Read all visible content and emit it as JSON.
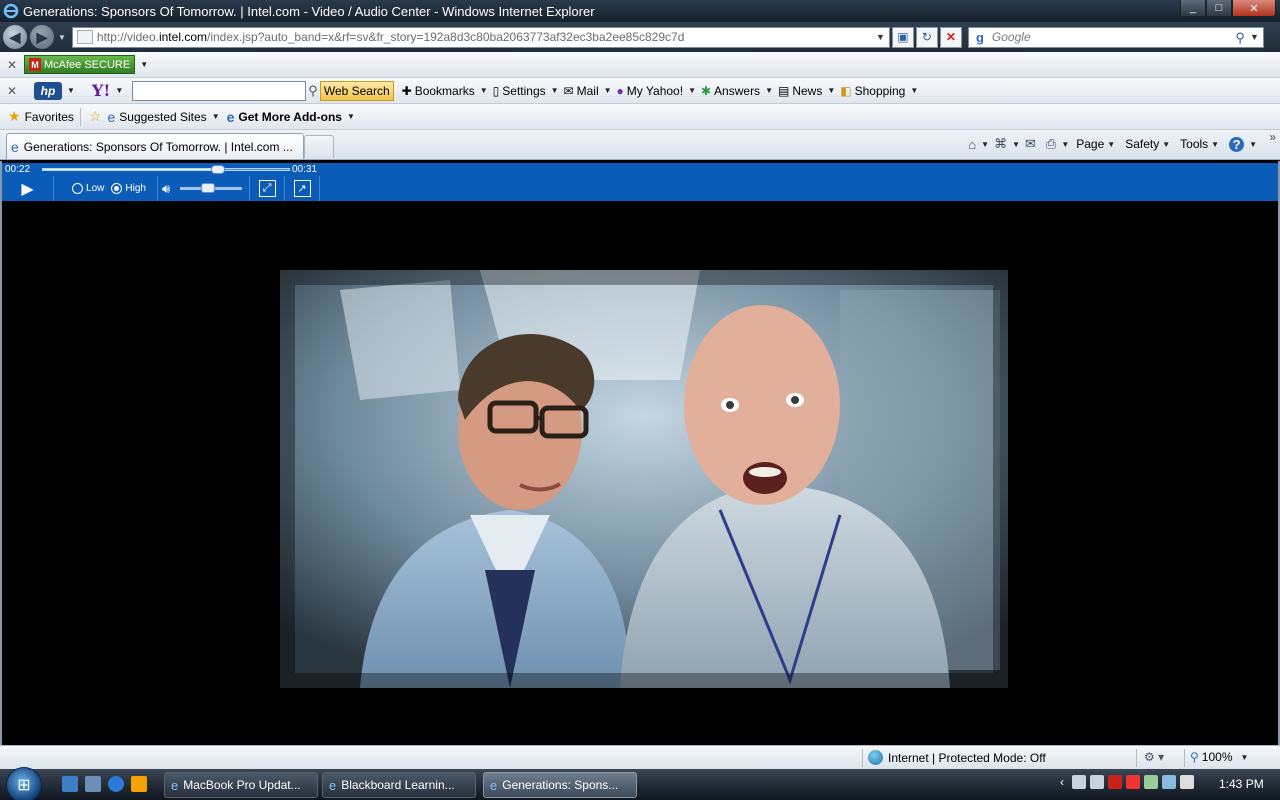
{
  "window": {
    "title": "Generations: Sponsors Of Tomorrow. | Intel.com - Video / Audio Center - Windows Internet Explorer",
    "min": "_",
    "max": "□",
    "close": "✕"
  },
  "address_bar": {
    "url_prefix": "http://video.",
    "url_domain": "intel.com",
    "url_suffix": "/index.jsp?auto_band=x&rf=sv&fr_story=192a8d3c80ba2063773af32ec3ba2ee85c829c7d",
    "search_placeholder": "Google"
  },
  "toolbar1": {
    "mcafee_label": "McAfee SECURE"
  },
  "toolbar2": {
    "hp_label": "hp",
    "yahoo_label": "Y!",
    "web_search": "Web Search",
    "bookmarks": "Bookmarks",
    "settings": "Settings",
    "mail": "Mail",
    "my_yahoo": "My Yahoo!",
    "answers": "Answers",
    "news": "News",
    "shopping": "Shopping"
  },
  "favorites_bar": {
    "favorites": "Favorites",
    "suggested_sites": "Suggested Sites",
    "get_addons": "Get More Add-ons"
  },
  "tabs": [
    {
      "label": "Generations: Sponsors Of Tomorrow. | Intel.com ..."
    }
  ],
  "command_bar": {
    "page": "Page",
    "safety": "Safety",
    "tools": "Tools"
  },
  "player": {
    "time_current": "00:22",
    "time_total": "00:31",
    "progress": 0.71,
    "quality_low": "Low",
    "quality_high": "High",
    "selected_quality": "High",
    "volume": 0.45
  },
  "status_bar": {
    "zone": "Internet | Protected Mode: Off",
    "zoom": "100%"
  },
  "taskbar": {
    "buttons": [
      {
        "label": "MacBook Pro Updat..."
      },
      {
        "label": "Blackboard Learnin..."
      },
      {
        "label": "Generations: Spons..."
      }
    ],
    "clock": "1:43 PM"
  }
}
